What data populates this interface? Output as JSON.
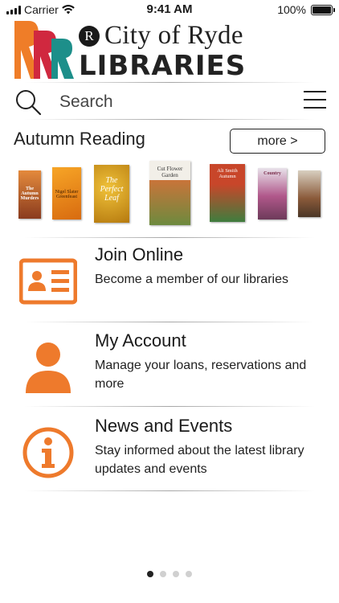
{
  "status_bar": {
    "carrier": "Carrier",
    "time": "9:41 AM",
    "battery": "100%",
    "icons": [
      "signal-icon",
      "wifi-icon",
      "battery-icon"
    ]
  },
  "logo": {
    "seal_letter": "R",
    "city": "City of Ryde",
    "libraries": "LIBRARIES",
    "colors": {
      "orange": "#ef7d28",
      "red": "#d0283f",
      "teal": "#1d8f8a"
    }
  },
  "search": {
    "placeholder": "Search",
    "icon": "search-icon",
    "menu_icon": "menu-icon"
  },
  "autumn_reading": {
    "title": "Autumn Reading",
    "more_label": "more >",
    "books": [
      {
        "title": "The Autumn Murders",
        "icon": "book-cover"
      },
      {
        "title": "Nigel Slater Greenfeast",
        "icon": "book-cover"
      },
      {
        "title": "The Perfect Leaf",
        "icon": "book-cover"
      },
      {
        "title": "Cut Flower Garden",
        "icon": "book-cover"
      },
      {
        "title": "Ali Smith Autumn",
        "icon": "book-cover"
      },
      {
        "title": "Country",
        "icon": "book-cover"
      },
      {
        "title": "",
        "icon": "book-cover"
      }
    ]
  },
  "features": [
    {
      "title": "Join Online",
      "desc": "Become a member of our libraries",
      "icon": "id-card-icon"
    },
    {
      "title": "My Account",
      "desc": "Manage your loans, reservations and more",
      "icon": "user-icon"
    },
    {
      "title": "News and Events",
      "desc": "Stay informed about the latest library updates and events",
      "icon": "info-icon"
    }
  ],
  "accent_color": "#ee7a2c",
  "pagination": {
    "pages": 4,
    "current": 1
  }
}
